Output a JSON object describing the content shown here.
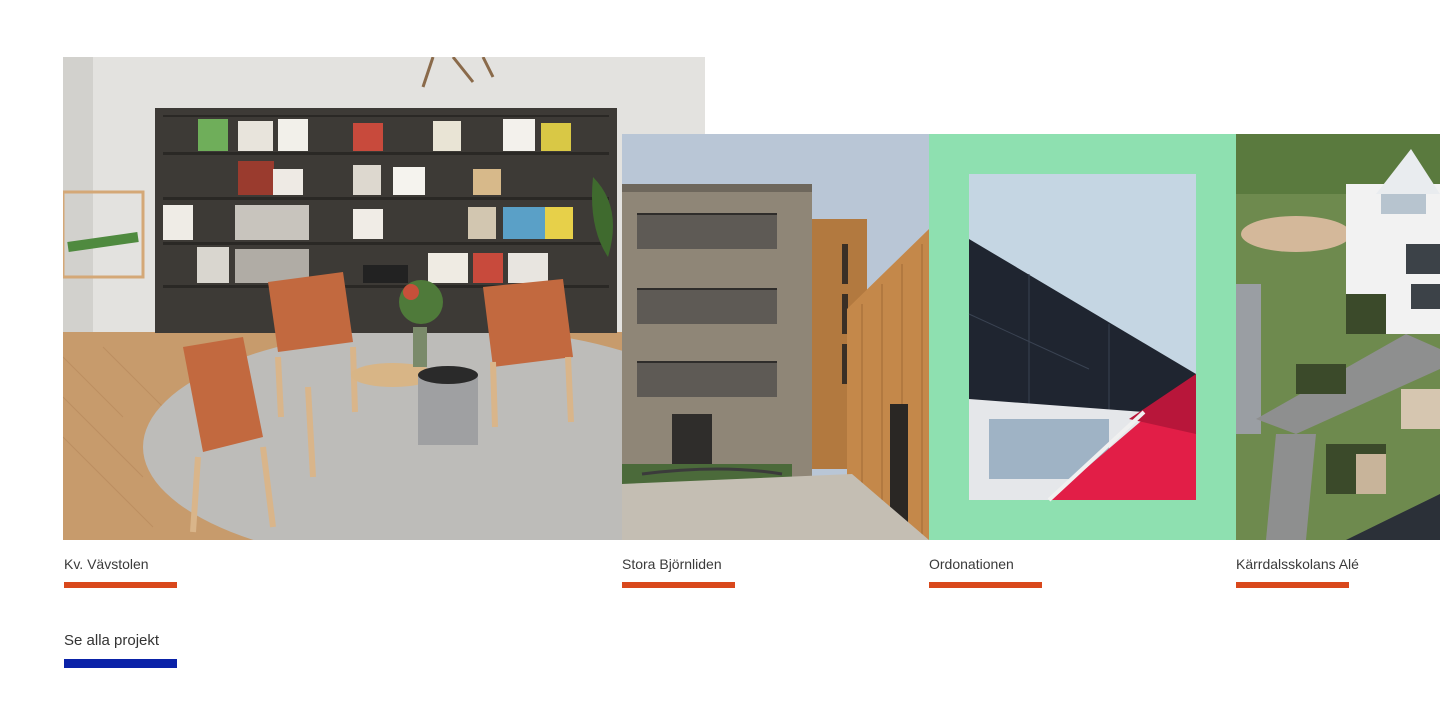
{
  "colors": {
    "accent": "#d9481c",
    "link_bar": "#0a22a8",
    "mint": "#8ee0b0"
  },
  "projects": [
    {
      "title": "Kv. Vävstolen",
      "image": "living-room-photo"
    },
    {
      "title": "Stora Björnliden",
      "image": "apartment-building-photo"
    },
    {
      "title": "Ordonationen",
      "image": "facade-detail-photo"
    },
    {
      "title": "Kärrdalsskolans Alé",
      "image": "school-courtyard-aerial-photo"
    }
  ],
  "see_all": {
    "label": "Se alla projekt"
  }
}
